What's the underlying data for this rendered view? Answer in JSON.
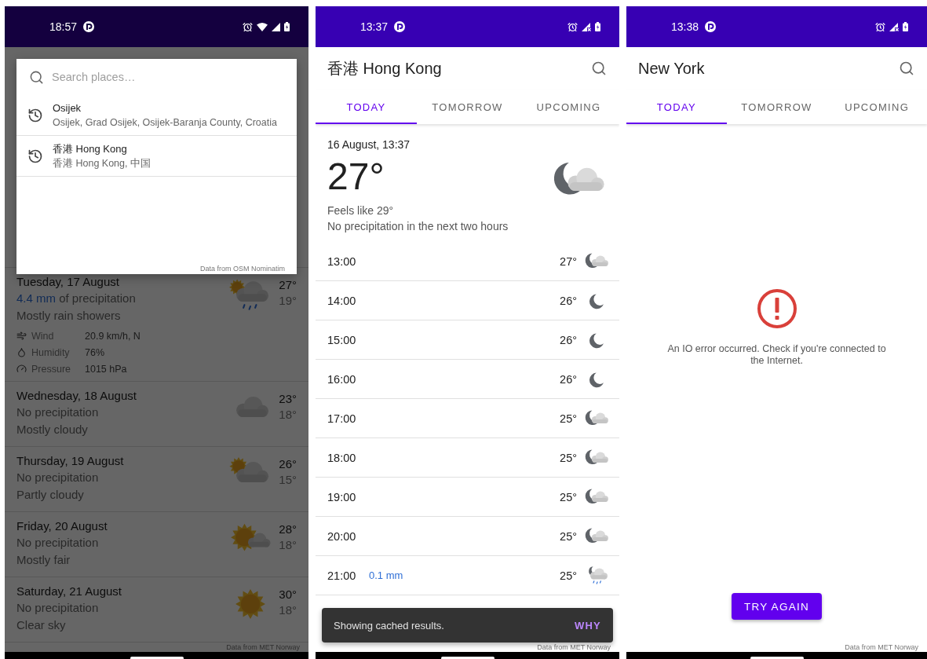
{
  "screens": [
    {
      "kind": "search_overlay",
      "status_bar": {
        "time": "18:57"
      },
      "days": [
        {
          "date": "Tuesday, 17 August",
          "precipitation_amount": "4.4 mm",
          "precipitation": "of precipitation",
          "description": "Mostly rain showers",
          "high": "27°",
          "low": "19°",
          "kind": "rain_showers",
          "details": [
            {
              "kind": "wind",
              "label": "Wind",
              "value": "20.9 km/h, N"
            },
            {
              "kind": "humidity",
              "label": "Humidity",
              "value": "76%"
            },
            {
              "kind": "pressure",
              "label": "Pressure",
              "value": "1015 hPa"
            }
          ]
        },
        {
          "date": "Wednesday, 18 August",
          "precipitation": "No precipitation",
          "description": "Mostly cloudy",
          "high": "23°",
          "low": "18°",
          "kind": "cloudy"
        },
        {
          "date": "Thursday, 19 August",
          "precipitation": "No precipitation",
          "description": "Partly cloudy",
          "high": "26°",
          "low": "15°",
          "kind": "partly_cloudy"
        },
        {
          "date": "Friday, 20 August",
          "precipitation": "No precipitation",
          "description": "Mostly fair",
          "high": "28°",
          "low": "18°",
          "kind": "fair"
        },
        {
          "date": "Saturday, 21 August",
          "precipitation": "No precipitation",
          "description": "Clear sky",
          "high": "30°",
          "low": "18°",
          "kind": "clear"
        }
      ],
      "attribution": "Data from MET Norway",
      "search_dialog": {
        "placeholder": "Search places…",
        "results": [
          {
            "name": "Osijek",
            "address": "Osijek, Grad Osijek, Osijek-Baranja County, Croatia"
          },
          {
            "name": "香港 Hong Kong",
            "address": "香港 Hong Kong, 中国"
          }
        ],
        "attribution": "Data from OSM Nominatim"
      }
    },
    {
      "kind": "forecast",
      "status_bar": {
        "time": "13:37"
      },
      "title": "香港 Hong Kong",
      "tabs": [
        {
          "label": "TODAY",
          "selected": true
        },
        {
          "label": "TOMORROW",
          "selected": false
        },
        {
          "label": "UPCOMING",
          "selected": false
        }
      ],
      "current": {
        "datetime": "16 August, 13:37",
        "temperature": "27°",
        "feels_like": "Feels like 29°",
        "precipitation": "No precipitation in the next two hours",
        "kind": "moon_cloud"
      },
      "hours": [
        {
          "time": "13:00",
          "temperature": "27°",
          "kind": "moon_cloud"
        },
        {
          "time": "14:00",
          "temperature": "26°",
          "kind": "moon"
        },
        {
          "time": "15:00",
          "temperature": "26°",
          "kind": "moon"
        },
        {
          "time": "16:00",
          "temperature": "26°",
          "kind": "moon"
        },
        {
          "time": "17:00",
          "temperature": "25°",
          "kind": "moon_cloud"
        },
        {
          "time": "18:00",
          "temperature": "25°",
          "kind": "moon_cloud"
        },
        {
          "time": "19:00",
          "temperature": "25°",
          "kind": "moon_cloud"
        },
        {
          "time": "20:00",
          "temperature": "25°",
          "kind": "moon_cloud"
        },
        {
          "time": "21:00",
          "precipitation": "0.1 mm",
          "temperature": "25°",
          "kind": "moon_cloud_rain"
        }
      ],
      "snackbar": {
        "message": "Showing cached results.",
        "action": "WHY"
      },
      "attribution": "Data from MET Norway"
    },
    {
      "kind": "error",
      "status_bar": {
        "time": "13:38"
      },
      "title": "New York",
      "tabs": [
        {
          "label": "TODAY",
          "selected": true
        },
        {
          "label": "TOMORROW",
          "selected": false
        },
        {
          "label": "UPCOMING",
          "selected": false
        }
      ],
      "error": {
        "message": "An IO error occurred. Check if you're connected to the Internet.",
        "button": "TRY AGAIN"
      },
      "attribution": "Data from MET Norway"
    }
  ]
}
